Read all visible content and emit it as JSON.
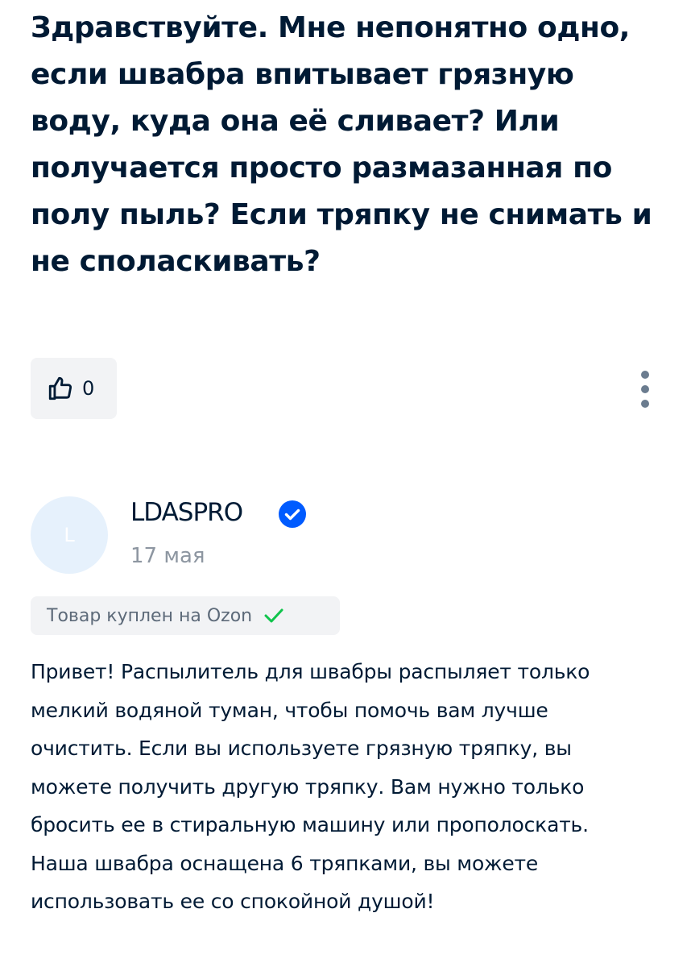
{
  "question": {
    "text": "Здравствуйте. Мне непонятно одно, если швабра впитывает грязную воду, куда она её сливает? Или получается просто размазанная по полу пыль? Если тряпку не снимать и не споласкивать?"
  },
  "actions": {
    "like_count": "0",
    "like_icon": "thumbs-up-icon",
    "more_icon": "more-vertical-icon"
  },
  "answer": {
    "author": {
      "avatar_letter": "L",
      "name": "LDASPRO",
      "verified_icon": "verified-check-icon",
      "verified_color": "#005bff"
    },
    "date": "17 мая",
    "purchase_badge": {
      "text": "Товар куплен на Ozon",
      "icon": "check-icon",
      "icon_color": "#10c44c"
    },
    "text": "Привет! Распылитель для швабры распыляет только мелкий водяной туман, чтобы помочь вам лучше очистить. Если вы используете грязную тряпку, вы можете получить другую тряпку. Вам нужно только бросить ее в стиральную машину или прополоскать. Наша швабра оснащена 6 тряпками, вы можете использовать ее со спокойной душой!"
  }
}
